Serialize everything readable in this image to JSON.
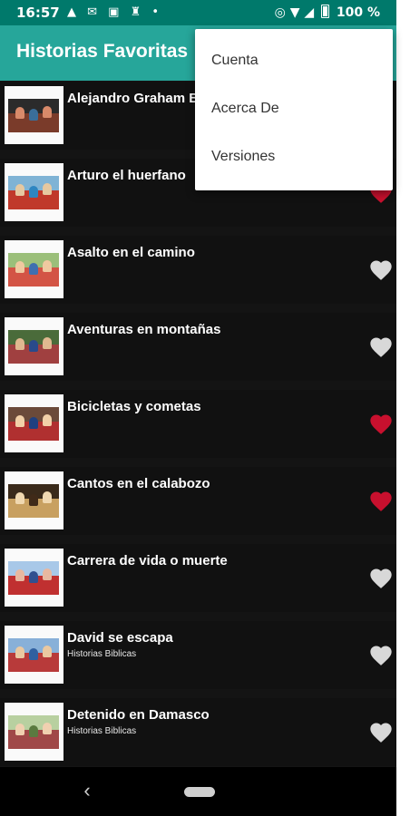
{
  "status_bar": {
    "time": "16:57",
    "battery": "100 %"
  },
  "app_bar": {
    "title": "Historias Favoritas"
  },
  "overflow_menu": {
    "items": [
      {
        "label": "Cuenta"
      },
      {
        "label": "Acerca De"
      },
      {
        "label": "Versiones"
      }
    ]
  },
  "stories": [
    {
      "title": "Alejandro Graham Bell",
      "subtitle": "",
      "favorite": false
    },
    {
      "title": "Arturo el huerfano",
      "subtitle": "",
      "favorite": true
    },
    {
      "title": "Asalto en el camino",
      "subtitle": "",
      "favorite": false
    },
    {
      "title": "Aventuras en montañas",
      "subtitle": "",
      "favorite": false
    },
    {
      "title": "Bicicletas y cometas",
      "subtitle": "",
      "favorite": true
    },
    {
      "title": "Cantos en el calabozo",
      "subtitle": "",
      "favorite": true
    },
    {
      "title": "Carrera de vida o muerte",
      "subtitle": "",
      "favorite": false
    },
    {
      "title": "David se escapa",
      "subtitle": "Historias Biblicas",
      "favorite": false
    },
    {
      "title": "Detenido en Damasco",
      "subtitle": "Historias Biblicas",
      "favorite": false
    }
  ],
  "colors": {
    "favorite": "#c8102e",
    "not_favorite": "#d8d8d8",
    "app_bar": "#26a69a",
    "status_bar": "#00796b"
  },
  "nav_bar": {
    "back_icon": "chevron-left-icon",
    "home_icon": "home-pill-icon"
  }
}
